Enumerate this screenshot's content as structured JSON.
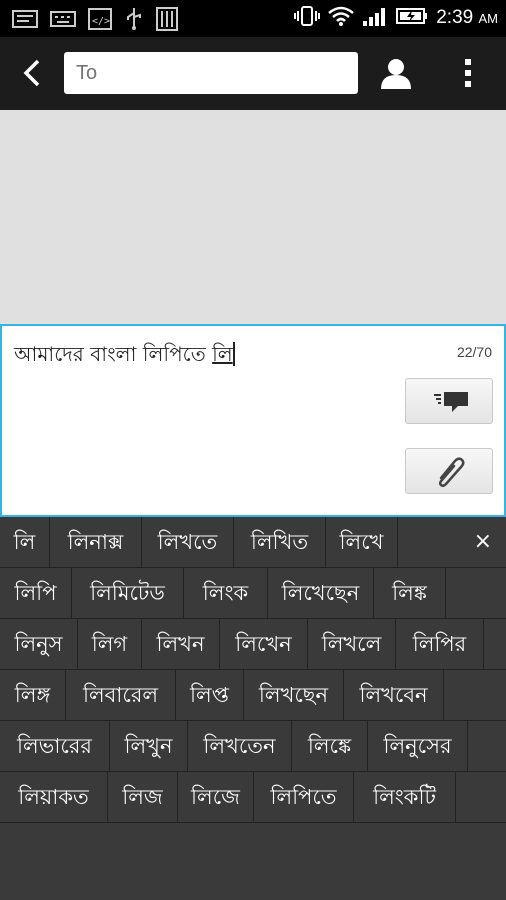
{
  "status_bar": {
    "time": "2:39",
    "ampm": "AM"
  },
  "toolbar": {
    "to_placeholder": "To"
  },
  "compose": {
    "message_prefix": "আমাদের বাংলা লিপিতে ",
    "current_word": "লি",
    "char_count": "22/70"
  },
  "suggestions": {
    "rows": [
      [
        "লি",
        "লিনাক্স",
        "লিখতে",
        "লিখিত",
        "লিখে"
      ],
      [
        "লিপি",
        "লিমিটেড",
        "লিংক",
        "লিখেছেন",
        "লিঙ্ক"
      ],
      [
        "লিনুস",
        "লিগ",
        "লিখন",
        "লিখেন",
        "লিখলে",
        "লিপির"
      ],
      [
        "লিঙ্গ",
        "লিবারেল",
        "লিপ্ত",
        "লিখছেন",
        "লিখবেন"
      ],
      [
        "লিভারের",
        "লিখুন",
        "লিখতেন",
        "লিঙ্কে",
        "লিনুসের"
      ],
      [
        "লিয়াকত",
        "লিজ",
        "লিজে",
        "লিপিতে",
        "লিংকটি"
      ]
    ],
    "close_label": "×"
  }
}
